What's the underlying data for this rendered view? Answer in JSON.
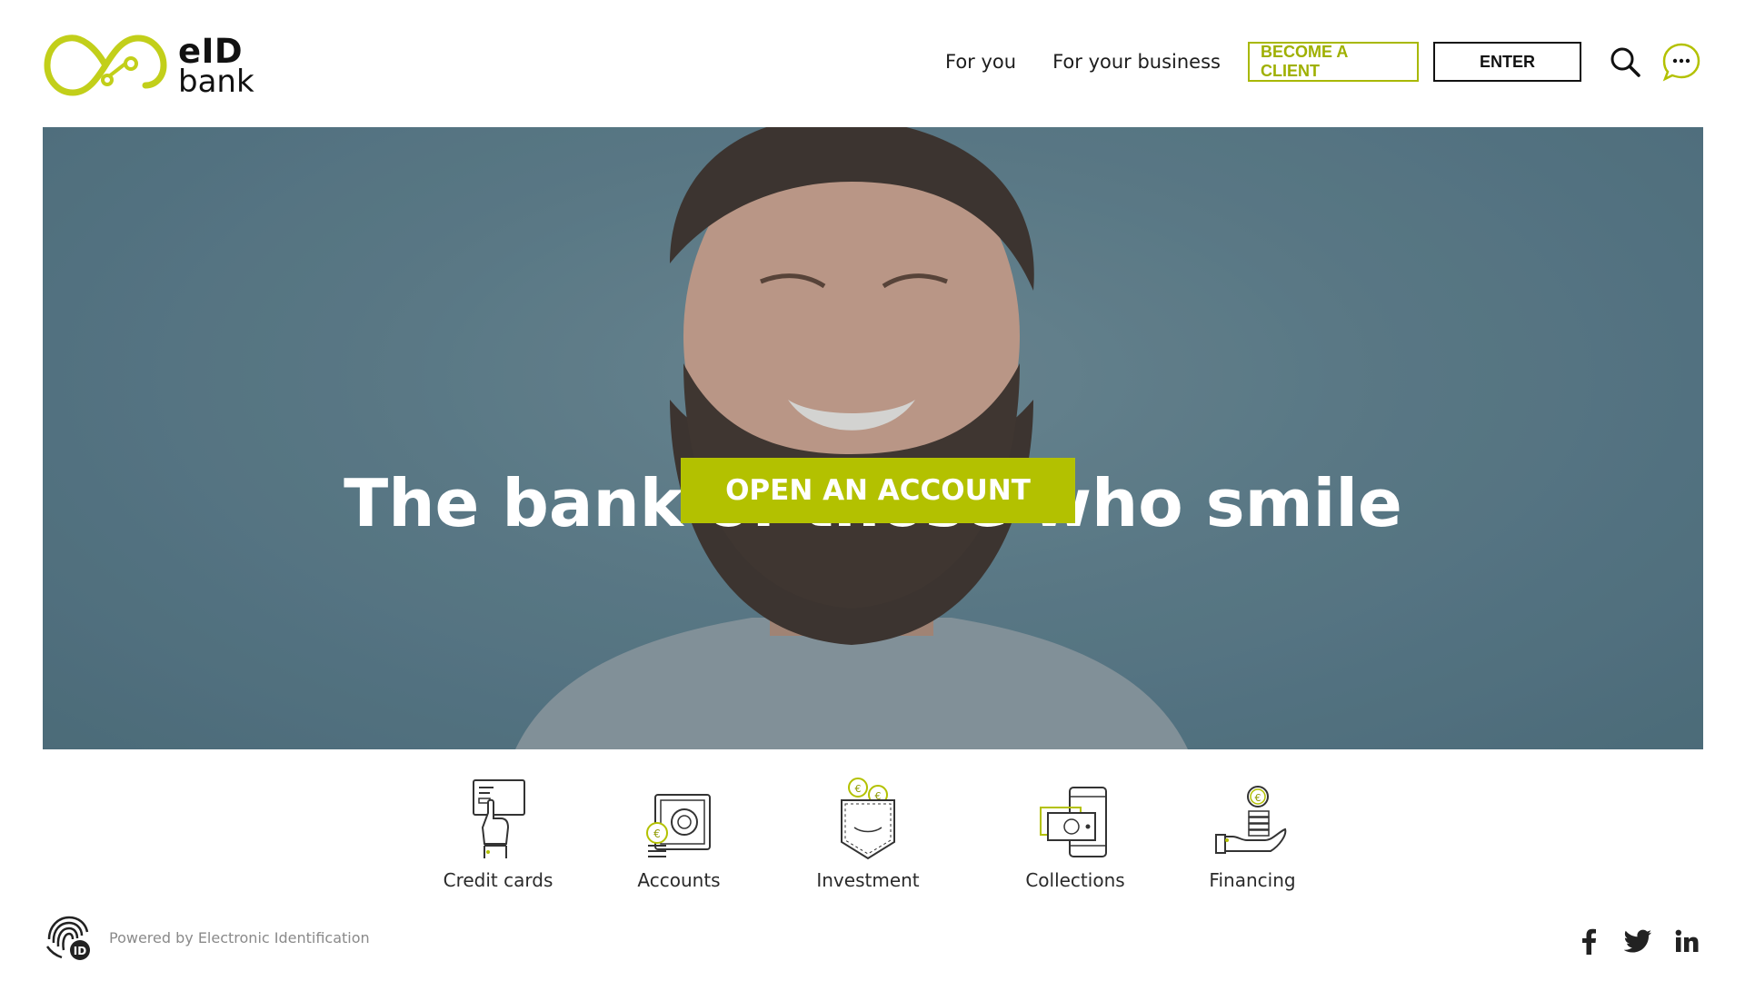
{
  "brand": {
    "logo_line1": "eID",
    "logo_line2": "bank",
    "accent_color": "#b3c100"
  },
  "nav": {
    "for_you": "For you",
    "for_business": "For your business",
    "become_client": "BECOME A CLIENT",
    "enter": "ENTER",
    "search_icon": "search-icon",
    "chat_icon": "chat-bubble-icon"
  },
  "hero": {
    "title": "The bank of those who smile",
    "cta": "OPEN AN ACCOUNT"
  },
  "categories": [
    {
      "label": "Credit cards",
      "icon": "credit-card-icon"
    },
    {
      "label": "Accounts",
      "icon": "safe-icon"
    },
    {
      "label": "Investment",
      "icon": "wallet-icon"
    },
    {
      "label": "Collections",
      "icon": "phone-payment-icon"
    },
    {
      "label": "Financing",
      "icon": "hand-coins-icon"
    }
  ],
  "footer": {
    "powered_by": "Powered by Electronic Identification",
    "social": [
      "facebook-icon",
      "twitter-icon",
      "linkedin-icon"
    ]
  }
}
